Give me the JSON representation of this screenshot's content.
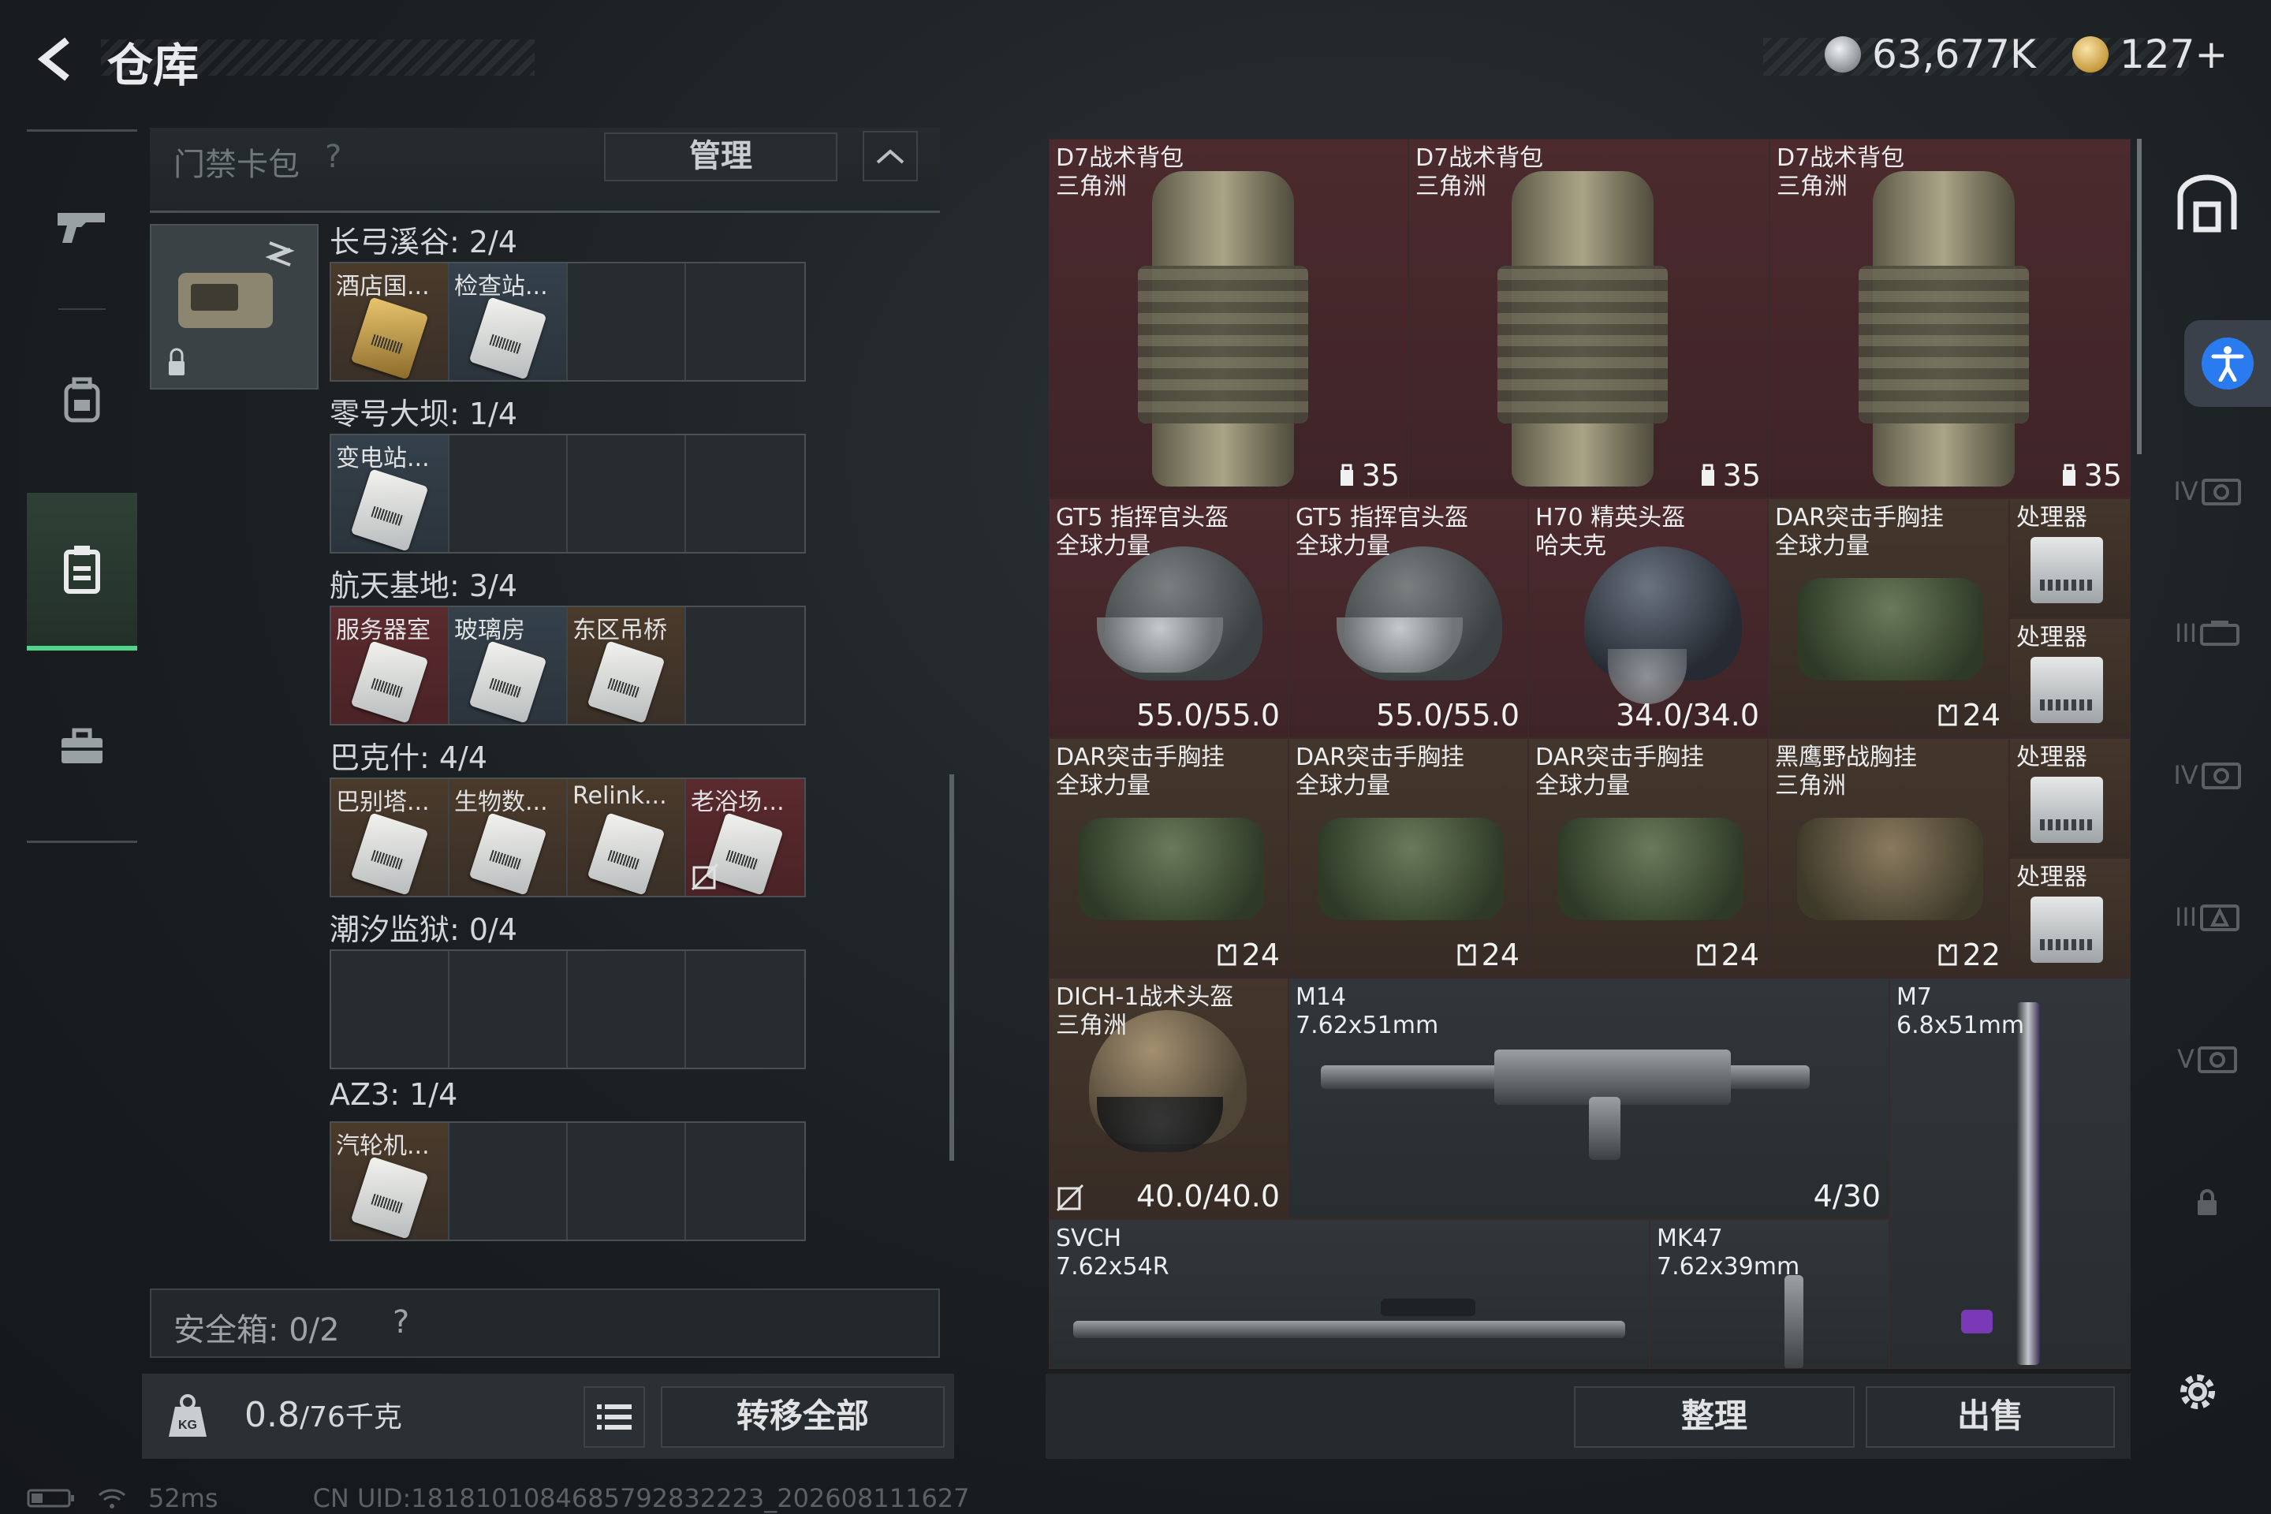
{
  "header": {
    "title": "仓库",
    "currency_silver": "63,677K",
    "currency_gold": "127+"
  },
  "left_panel": {
    "card_bag_label": "门禁卡包",
    "help_glyph": "?",
    "manage_label": "管理",
    "regions": [
      {
        "title": "长弓溪谷: 2/4",
        "slots": [
          "酒店国...",
          "检查站...",
          "",
          ""
        ]
      },
      {
        "title": "零号大坝: 1/4",
        "slots": [
          "变电站...",
          "",
          "",
          ""
        ]
      },
      {
        "title": "航天基地: 3/4",
        "slots": [
          "服务器室",
          "玻璃房",
          "东区吊桥",
          ""
        ]
      },
      {
        "title": "巴克什: 4/4",
        "slots": [
          "巴别塔...",
          "生物数...",
          "Relink...",
          "老浴场..."
        ]
      },
      {
        "title": "潮汐监狱: 0/4",
        "slots": [
          "",
          "",
          "",
          ""
        ]
      },
      {
        "title": "AZ3: 1/4",
        "slots": [
          "汽轮机...",
          "",
          "",
          ""
        ]
      }
    ],
    "safe_box_label": "安全箱: 0/2",
    "weight_value": "0.8",
    "weight_capacity": "/76千克",
    "transfer_all_label": "转移全部"
  },
  "grid": {
    "items": [
      {
        "id": "bp1",
        "name": "D7战术背包",
        "sub": "三角洲",
        "stat": "35"
      },
      {
        "id": "bp2",
        "name": "D7战术背包",
        "sub": "三角洲",
        "stat": "35"
      },
      {
        "id": "bp3",
        "name": "D7战术背包",
        "sub": "三角洲",
        "stat": "35"
      },
      {
        "id": "h1",
        "name": "GT5 指挥官头盔",
        "sub": "全球力量",
        "stat": "55.0/55.0"
      },
      {
        "id": "h2",
        "name": "GT5 指挥官头盔",
        "sub": "全球力量",
        "stat": "55.0/55.0"
      },
      {
        "id": "h3",
        "name": "H70 精英头盔",
        "sub": "哈夫克",
        "stat": "34.0/34.0"
      },
      {
        "id": "v1",
        "name": "DAR突击手胸挂",
        "sub": "全球力量",
        "stat": "24"
      },
      {
        "id": "p1",
        "name": "处理器",
        "sub": "",
        "stat": ""
      },
      {
        "id": "p2",
        "name": "处理器",
        "sub": "",
        "stat": ""
      },
      {
        "id": "v2",
        "name": "DAR突击手胸挂",
        "sub": "全球力量",
        "stat": "24"
      },
      {
        "id": "v3",
        "name": "DAR突击手胸挂",
        "sub": "全球力量",
        "stat": "24"
      },
      {
        "id": "v4",
        "name": "DAR突击手胸挂",
        "sub": "全球力量",
        "stat": "24"
      },
      {
        "id": "v5",
        "name": "黑鹰野战胸挂",
        "sub": "三角洲",
        "stat": "22"
      },
      {
        "id": "p3",
        "name": "处理器",
        "sub": "",
        "stat": ""
      },
      {
        "id": "p4",
        "name": "处理器",
        "sub": "",
        "stat": ""
      },
      {
        "id": "h4",
        "name": "DICH-1战术头盔",
        "sub": "三角洲",
        "stat": "40.0/40.0"
      },
      {
        "id": "w1",
        "name": "M14",
        "sub": "7.62x51mm",
        "stat": "4/30"
      },
      {
        "id": "w2",
        "name": "M7",
        "sub": "6.8x51mm",
        "stat": ""
      },
      {
        "id": "w3",
        "name": "SVCH",
        "sub": "7.62x54R",
        "stat": ""
      },
      {
        "id": "w4",
        "name": "MK47",
        "sub": "7.62x39mm",
        "stat": ""
      }
    ]
  },
  "right_bar": {
    "tiers": [
      "IV",
      "IV",
      "III",
      "IV",
      "III",
      "V"
    ]
  },
  "bottom_right": {
    "sort_label": "整理",
    "sell_label": "出售"
  },
  "footer": {
    "ping": "52ms",
    "uid": "CN UID:1818101084685792832223_202608111627"
  },
  "colors": {
    "accent_green": "#4ed58a",
    "accessibility_blue": "#2b7bf0",
    "rare_red": "#4c2a2e"
  }
}
